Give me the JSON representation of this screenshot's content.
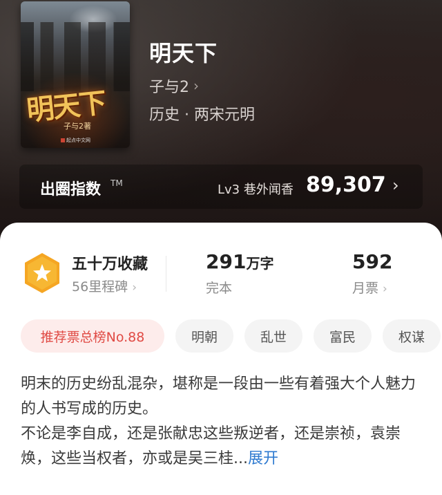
{
  "cover": {
    "title": "明天下",
    "author": "子与2著",
    "publisher": "起点中文网"
  },
  "book": {
    "title": "明天下",
    "author": "子与2",
    "genre": "历史 · 两宋元明"
  },
  "circle_index": {
    "label": "出圈指数",
    "tm": "TM",
    "level": "Lv3 巷外闻香",
    "value": "89,307"
  },
  "stats": {
    "collection_title": "五十万收藏",
    "collection_sub": "56里程碑",
    "words_value": "291",
    "words_unit": "万字",
    "words_status": "完本",
    "votes_value": "592",
    "votes_label": "月票"
  },
  "tags": [
    "推荐票总榜No.88",
    "明朝",
    "乱世",
    "富民",
    "权谋"
  ],
  "description": {
    "line1": "明末的历史纷乱混杂，堪称是一段由一些有着强大个人魅力的人书写成的历史。",
    "line2": "不论是李自成，还是张献忠这些叛逆者，还是崇祯，袁崇焕，这些当权者，亦或是吴三桂...",
    "expand": "展开"
  },
  "colors": {
    "accent_red": "#e04a44",
    "link_blue": "#2e7ad0",
    "badge_orange": "#f5a623"
  }
}
